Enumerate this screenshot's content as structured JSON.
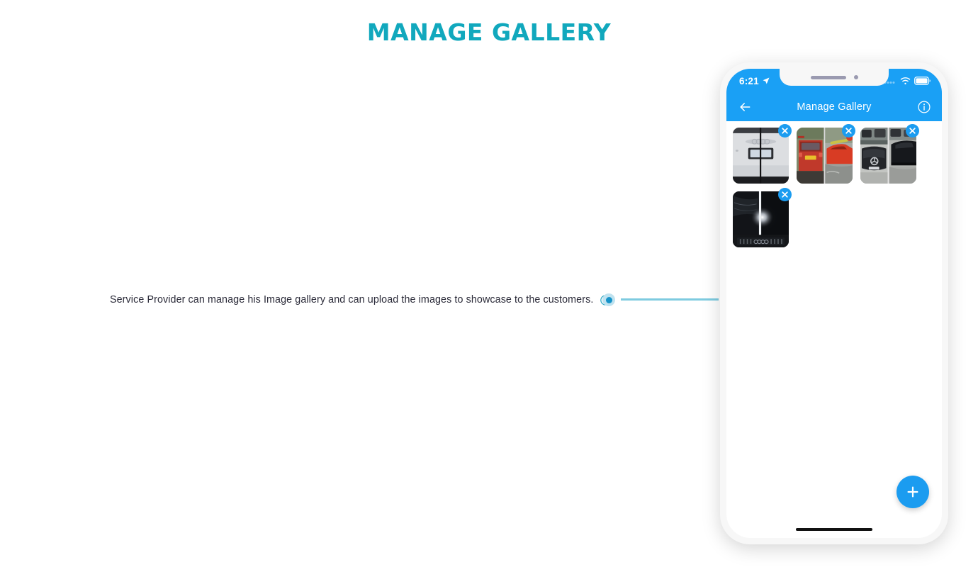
{
  "page": {
    "title": "MANAGE GALLERY",
    "title_color": "#11a8bd",
    "background": "#ffffff"
  },
  "annotation": {
    "caption": "Service Provider can manage his Image gallery and can upload the images to showcase to the customers.",
    "check_icon": "check-circle-icon",
    "check_icon_color": "#2aa8c4",
    "marker_icon": "dot-marker",
    "marker_color": "#1593c9",
    "marker_halo_color": "#bfe2ef",
    "connector_color": "#7ecbe0"
  },
  "phone": {
    "accent_color": "#1aa0f5",
    "status_bar": {
      "time": "6:21",
      "location_icon": "location-arrow-icon",
      "signal_icon": "signal-dots-icon",
      "wifi_icon": "wifi-icon",
      "battery_icon": "battery-icon"
    },
    "nav_bar": {
      "back_icon": "back-arrow-icon",
      "title": "Manage Gallery",
      "info_icon": "info-circle-icon"
    },
    "gallery": {
      "delete_badge_icon": "close-x-icon",
      "items": [
        {
          "alt": "White Audi rear with license plate",
          "id": "gallery-image-1"
        },
        {
          "alt": "Red car before and after wash",
          "id": "gallery-image-2"
        },
        {
          "alt": "Black Mercedes front and side",
          "id": "gallery-image-3"
        },
        {
          "alt": "Dark car with bright reflection",
          "id": "gallery-image-4"
        }
      ]
    },
    "fab": {
      "icon": "plus-icon",
      "label": "+",
      "color": "#1b9cf0"
    },
    "home_indicator": "home-indicator"
  }
}
